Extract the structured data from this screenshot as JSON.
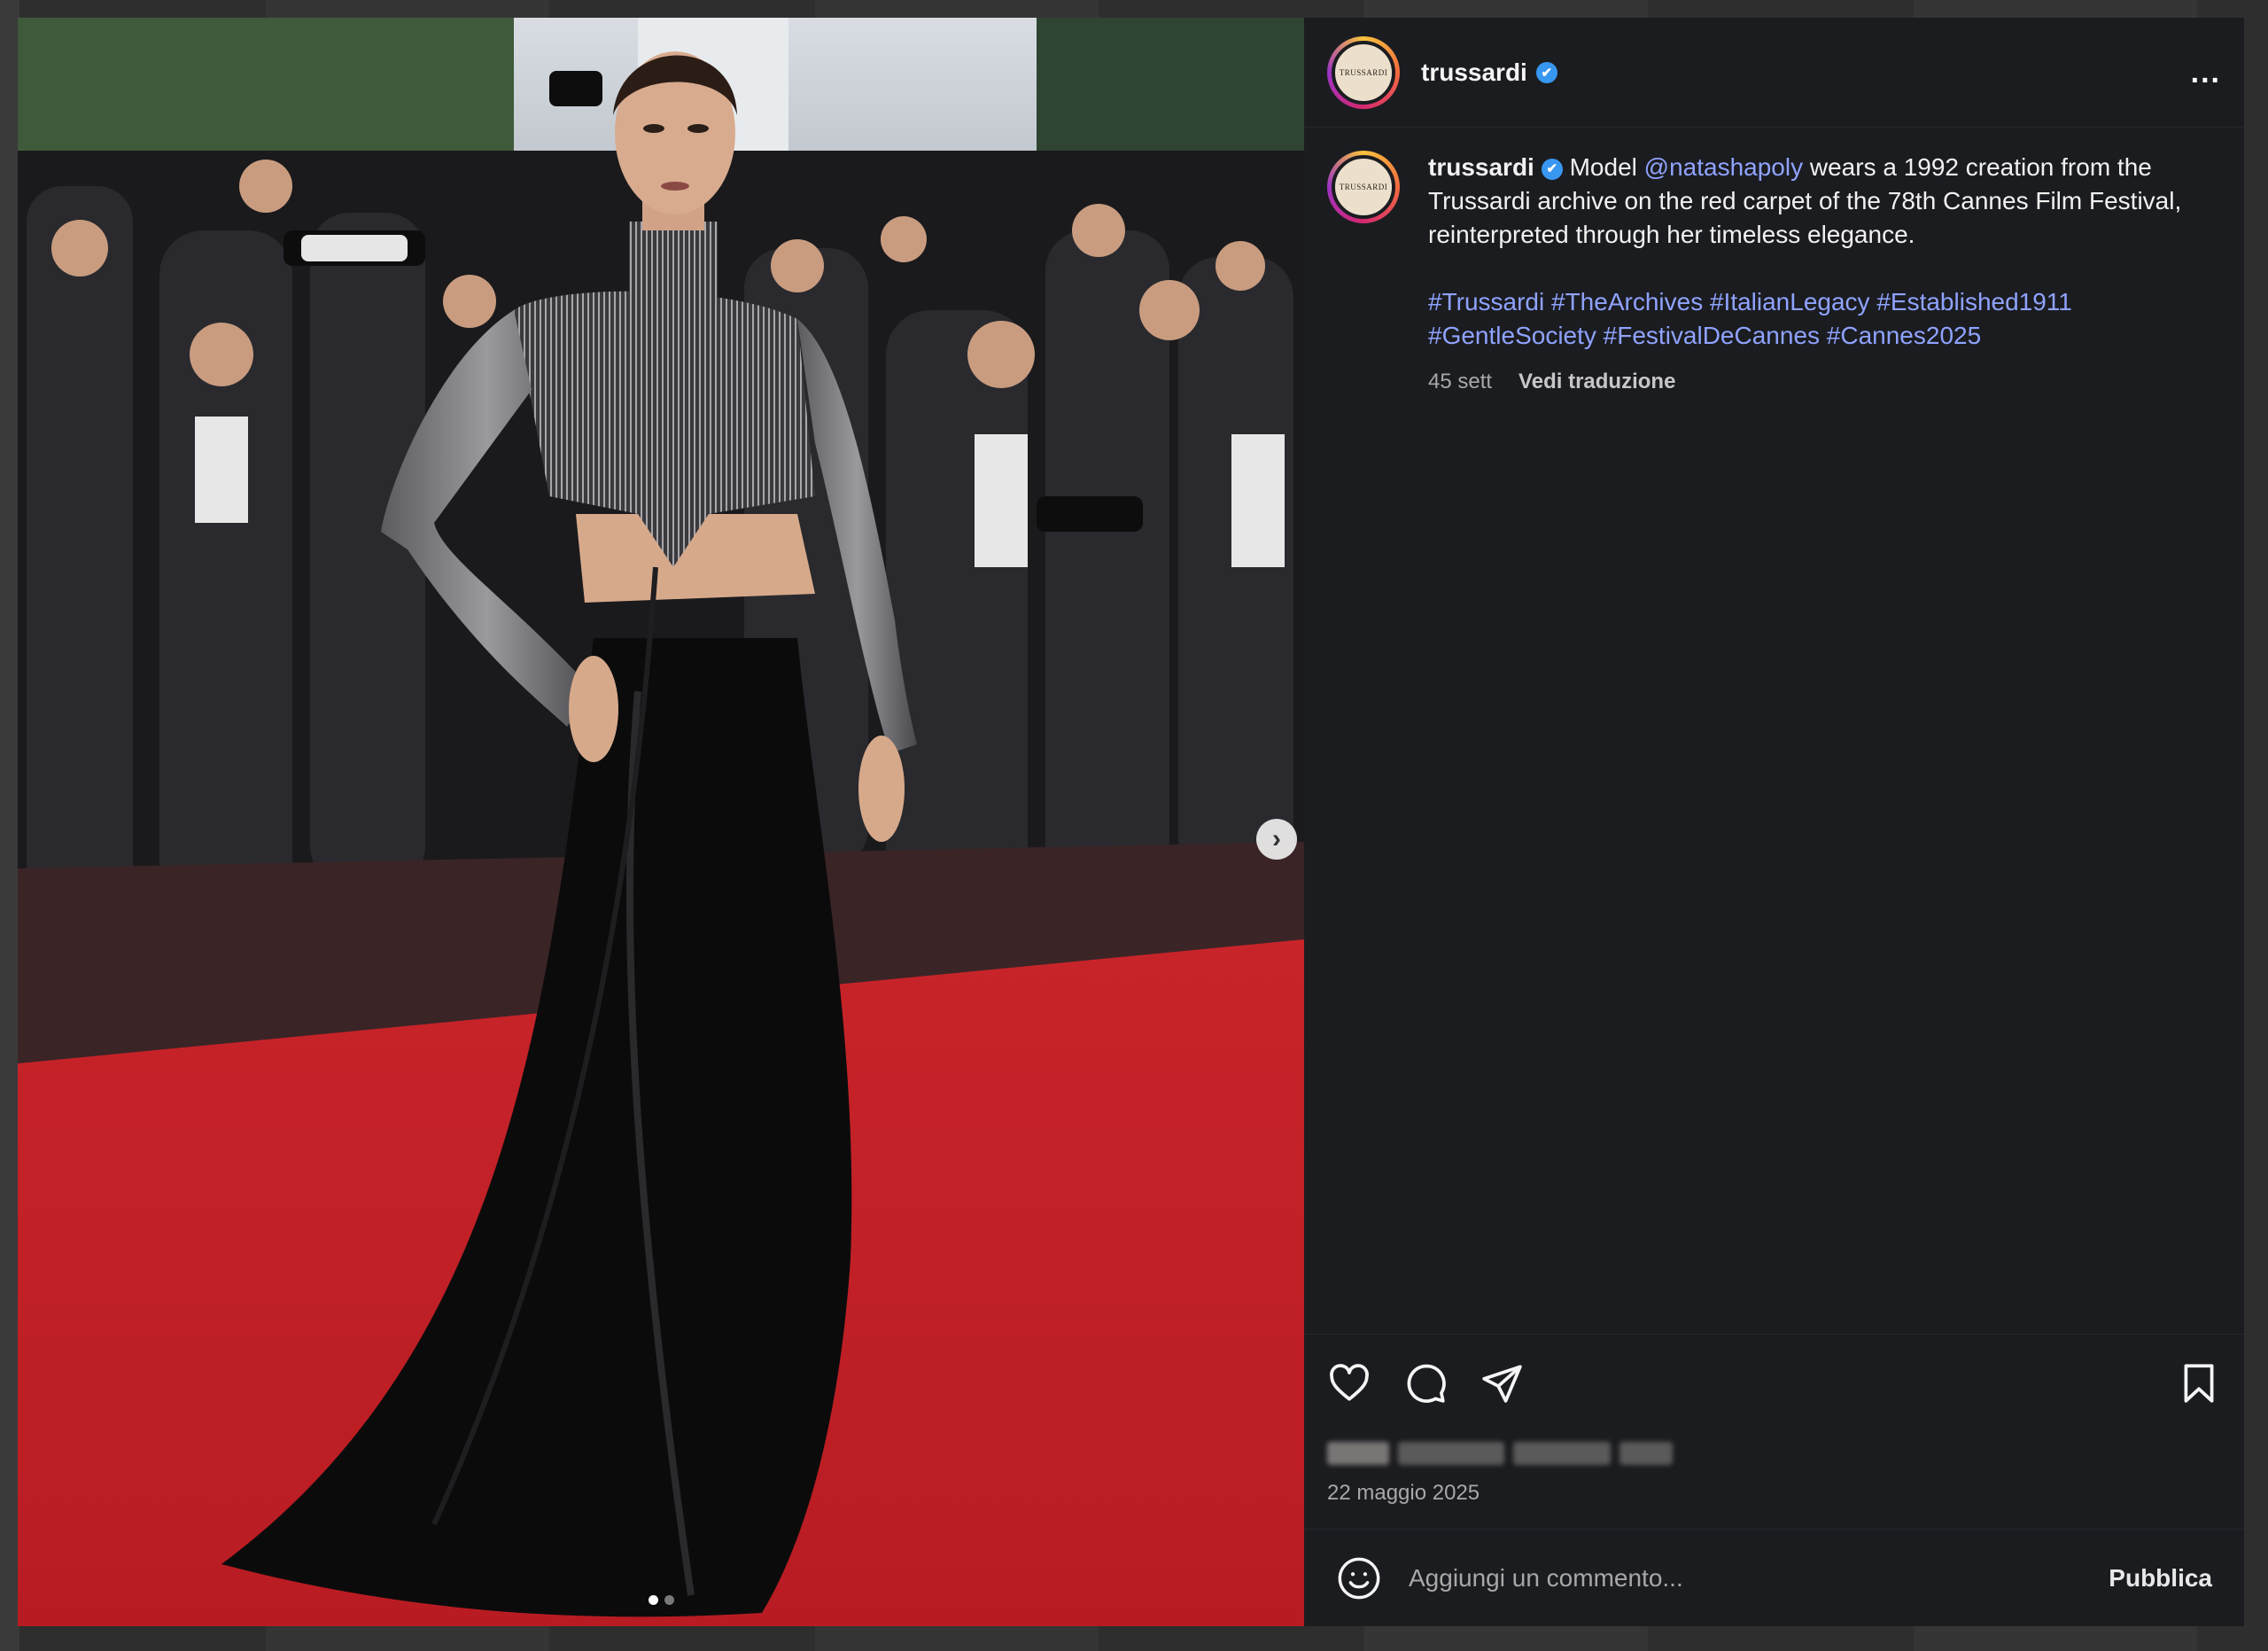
{
  "post": {
    "username": "trussardi",
    "verified_mark": "✔",
    "avatar_text": "TRUSSARDI",
    "more_options": "...",
    "caption": {
      "username": "trussardi",
      "text_before": " Model ",
      "mention": "@natashapoly",
      "text_after": " wears a 1992 creation from the Trussardi archive on the red carpet of the 78th Cannes Film Festival, reinterpreted through her timeless elegance.",
      "hashtags_line1": "#Trussardi #TheArchives #ItalianLegacy #Established1911",
      "hashtags_line2": "#GentleSociety #FestivalDeCannes #Cannes2025"
    },
    "age": "45 sett",
    "translate_label": "Vedi traduzione",
    "date": "22 maggio 2025",
    "comment_placeholder": "Aggiungi un commento...",
    "publish_label": "Pubblica",
    "carousel": {
      "count": 2,
      "active": 1,
      "next_glyph": "›"
    }
  },
  "icons": [
    "heart-icon",
    "comment-icon",
    "share-icon",
    "bookmark-icon",
    "emoji-icon",
    "chevron-right-icon",
    "verified-icon",
    "more-icon"
  ],
  "colors": {
    "accent": "#8fa3ff",
    "verified": "#3897f0",
    "panel": "#1b1c20"
  }
}
